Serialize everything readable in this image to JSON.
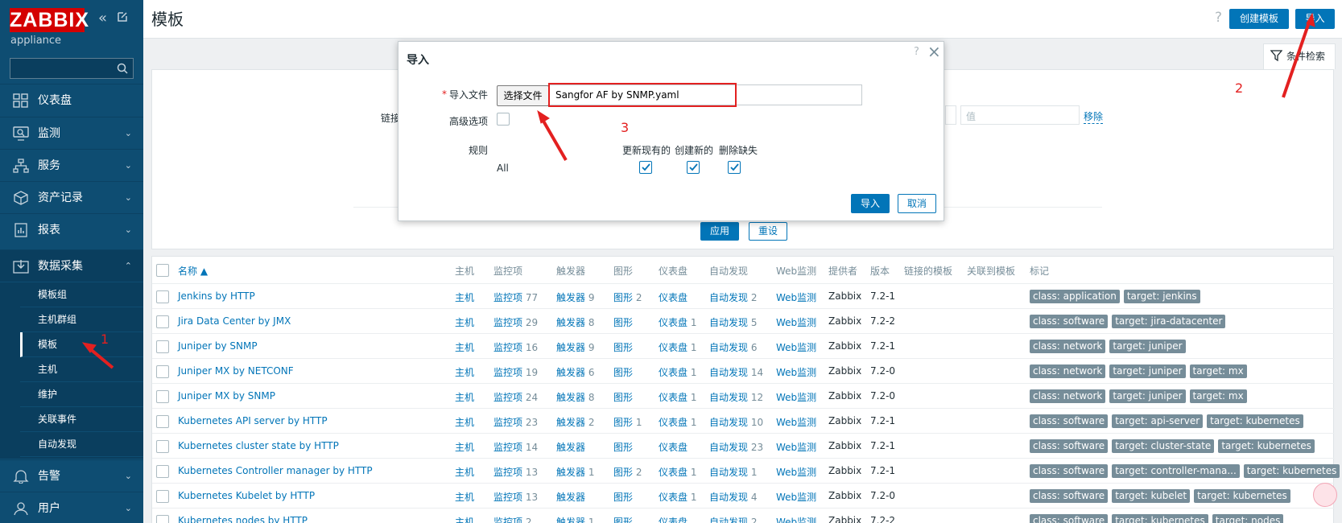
{
  "sidebar": {
    "logo": "ZABBIX",
    "subtitle": "appliance",
    "search_placeholder": "",
    "menu": [
      {
        "label": "仪表盘"
      },
      {
        "label": "监测"
      },
      {
        "label": "服务"
      },
      {
        "label": "资产记录"
      },
      {
        "label": "报表"
      },
      {
        "label": "数据采集"
      },
      {
        "label": "告警"
      },
      {
        "label": "用户"
      }
    ],
    "submenu": [
      "模板组",
      "主机群组",
      "模板",
      "主机",
      "维护",
      "关联事件",
      "自动发现"
    ]
  },
  "header": {
    "title": "模板",
    "help": "?",
    "create_label": "创建模板",
    "import_label": "导入"
  },
  "filter": {
    "tab_label": "条件检索",
    "link_label": "链接",
    "value_placeholder": "值",
    "remove_label": "移除",
    "apply_label": "应用",
    "reset_label": "重设"
  },
  "table": {
    "columns": [
      "名称 ▲",
      "主机",
      "监控项",
      "触发器",
      "图形",
      "仪表盘",
      "自动发现",
      "Web监测",
      "提供者",
      "版本",
      "链接的模板",
      "关联到模板",
      "标记"
    ],
    "rows": [
      {
        "name": "Jenkins by HTTP",
        "host": "主机",
        "items": "监控项",
        "items_n": "77",
        "triggers": "触发器",
        "triggers_n": "9",
        "graphs": "图形",
        "graphs_n": "2",
        "dash": "仪表盘",
        "dash_n": "",
        "disc": "自动发现",
        "disc_n": "2",
        "web": "Web监测",
        "vendor": "Zabbix",
        "version": "7.2-1",
        "tags": [
          "class: application",
          "target: jenkins"
        ]
      },
      {
        "name": "Jira Data Center by JMX",
        "host": "主机",
        "items": "监控项",
        "items_n": "29",
        "triggers": "触发器",
        "triggers_n": "8",
        "graphs": "图形",
        "graphs_n": "",
        "dash": "仪表盘",
        "dash_n": "1",
        "disc": "自动发现",
        "disc_n": "5",
        "web": "Web监测",
        "vendor": "Zabbix",
        "version": "7.2-2",
        "tags": [
          "class: software",
          "target: jira-datacenter"
        ]
      },
      {
        "name": "Juniper by SNMP",
        "host": "主机",
        "items": "监控项",
        "items_n": "16",
        "triggers": "触发器",
        "triggers_n": "9",
        "graphs": "图形",
        "graphs_n": "",
        "dash": "仪表盘",
        "dash_n": "1",
        "disc": "自动发现",
        "disc_n": "6",
        "web": "Web监测",
        "vendor": "Zabbix",
        "version": "7.2-1",
        "tags": [
          "class: network",
          "target: juniper"
        ]
      },
      {
        "name": "Juniper MX by NETCONF",
        "host": "主机",
        "items": "监控项",
        "items_n": "19",
        "triggers": "触发器",
        "triggers_n": "6",
        "graphs": "图形",
        "graphs_n": "",
        "dash": "仪表盘",
        "dash_n": "1",
        "disc": "自动发现",
        "disc_n": "14",
        "web": "Web监测",
        "vendor": "Zabbix",
        "version": "7.2-0",
        "tags": [
          "class: network",
          "target: juniper",
          "target: mx"
        ]
      },
      {
        "name": "Juniper MX by SNMP",
        "host": "主机",
        "items": "监控项",
        "items_n": "24",
        "triggers": "触发器",
        "triggers_n": "8",
        "graphs": "图形",
        "graphs_n": "",
        "dash": "仪表盘",
        "dash_n": "1",
        "disc": "自动发现",
        "disc_n": "12",
        "web": "Web监测",
        "vendor": "Zabbix",
        "version": "7.2-0",
        "tags": [
          "class: network",
          "target: juniper",
          "target: mx"
        ]
      },
      {
        "name": "Kubernetes API server by HTTP",
        "host": "主机",
        "items": "监控项",
        "items_n": "23",
        "triggers": "触发器",
        "triggers_n": "2",
        "graphs": "图形",
        "graphs_n": "1",
        "dash": "仪表盘",
        "dash_n": "1",
        "disc": "自动发现",
        "disc_n": "10",
        "web": "Web监测",
        "vendor": "Zabbix",
        "version": "7.2-1",
        "tags": [
          "class: software",
          "target: api-server",
          "target: kubernetes"
        ]
      },
      {
        "name": "Kubernetes cluster state by HTTP",
        "host": "主机",
        "items": "监控项",
        "items_n": "14",
        "triggers": "触发器",
        "triggers_n": "",
        "graphs": "图形",
        "graphs_n": "",
        "dash": "仪表盘",
        "dash_n": "",
        "disc": "自动发现",
        "disc_n": "23",
        "web": "Web监测",
        "vendor": "Zabbix",
        "version": "7.2-1",
        "tags": [
          "class: software",
          "target: cluster-state",
          "target: kubernetes"
        ]
      },
      {
        "name": "Kubernetes Controller manager by HTTP",
        "host": "主机",
        "items": "监控项",
        "items_n": "13",
        "triggers": "触发器",
        "triggers_n": "1",
        "graphs": "图形",
        "graphs_n": "2",
        "dash": "仪表盘",
        "dash_n": "1",
        "disc": "自动发现",
        "disc_n": "1",
        "web": "Web监测",
        "vendor": "Zabbix",
        "version": "7.2-1",
        "tags": [
          "class: software",
          "target: controller-mana...",
          "target: kubernetes"
        ]
      },
      {
        "name": "Kubernetes Kubelet by HTTP",
        "host": "主机",
        "items": "监控项",
        "items_n": "13",
        "triggers": "触发器",
        "triggers_n": "",
        "graphs": "图形",
        "graphs_n": "",
        "dash": "仪表盘",
        "dash_n": "1",
        "disc": "自动发现",
        "disc_n": "4",
        "web": "Web监测",
        "vendor": "Zabbix",
        "version": "7.2-0",
        "tags": [
          "class: software",
          "target: kubelet",
          "target: kubernetes"
        ]
      },
      {
        "name": "Kubernetes nodes by HTTP",
        "host": "主机",
        "items": "监控项",
        "items_n": "2",
        "triggers": "触发器",
        "triggers_n": "1",
        "graphs": "图形",
        "graphs_n": "",
        "dash": "仪表盘",
        "dash_n": "",
        "disc": "自动发现",
        "disc_n": "2",
        "web": "Web监测",
        "vendor": "Zabbix",
        "version": "7.2-2",
        "tags": [
          "class: software",
          "target: kubernetes",
          "target: nodes"
        ]
      }
    ]
  },
  "modal": {
    "title": "导入",
    "help": "?",
    "close": "×",
    "required_mark": "*",
    "file_label": "导入文件",
    "choose_file_label": "选择文件",
    "file_name": "Sangfor AF by SNMP.yaml",
    "advanced_label": "高级选项",
    "rules_label": "规则",
    "rule_all": "All",
    "col_update": "更新现有的",
    "col_create": "创建新的",
    "col_delete": "删除缺失",
    "import_label": "导入",
    "cancel_label": "取消"
  },
  "annotations": [
    "1",
    "2",
    "3"
  ],
  "colors": {
    "sidebar": "#0e4d72",
    "accent": "#0275b8",
    "logo": "#d40000",
    "annotation": "#e32020"
  }
}
